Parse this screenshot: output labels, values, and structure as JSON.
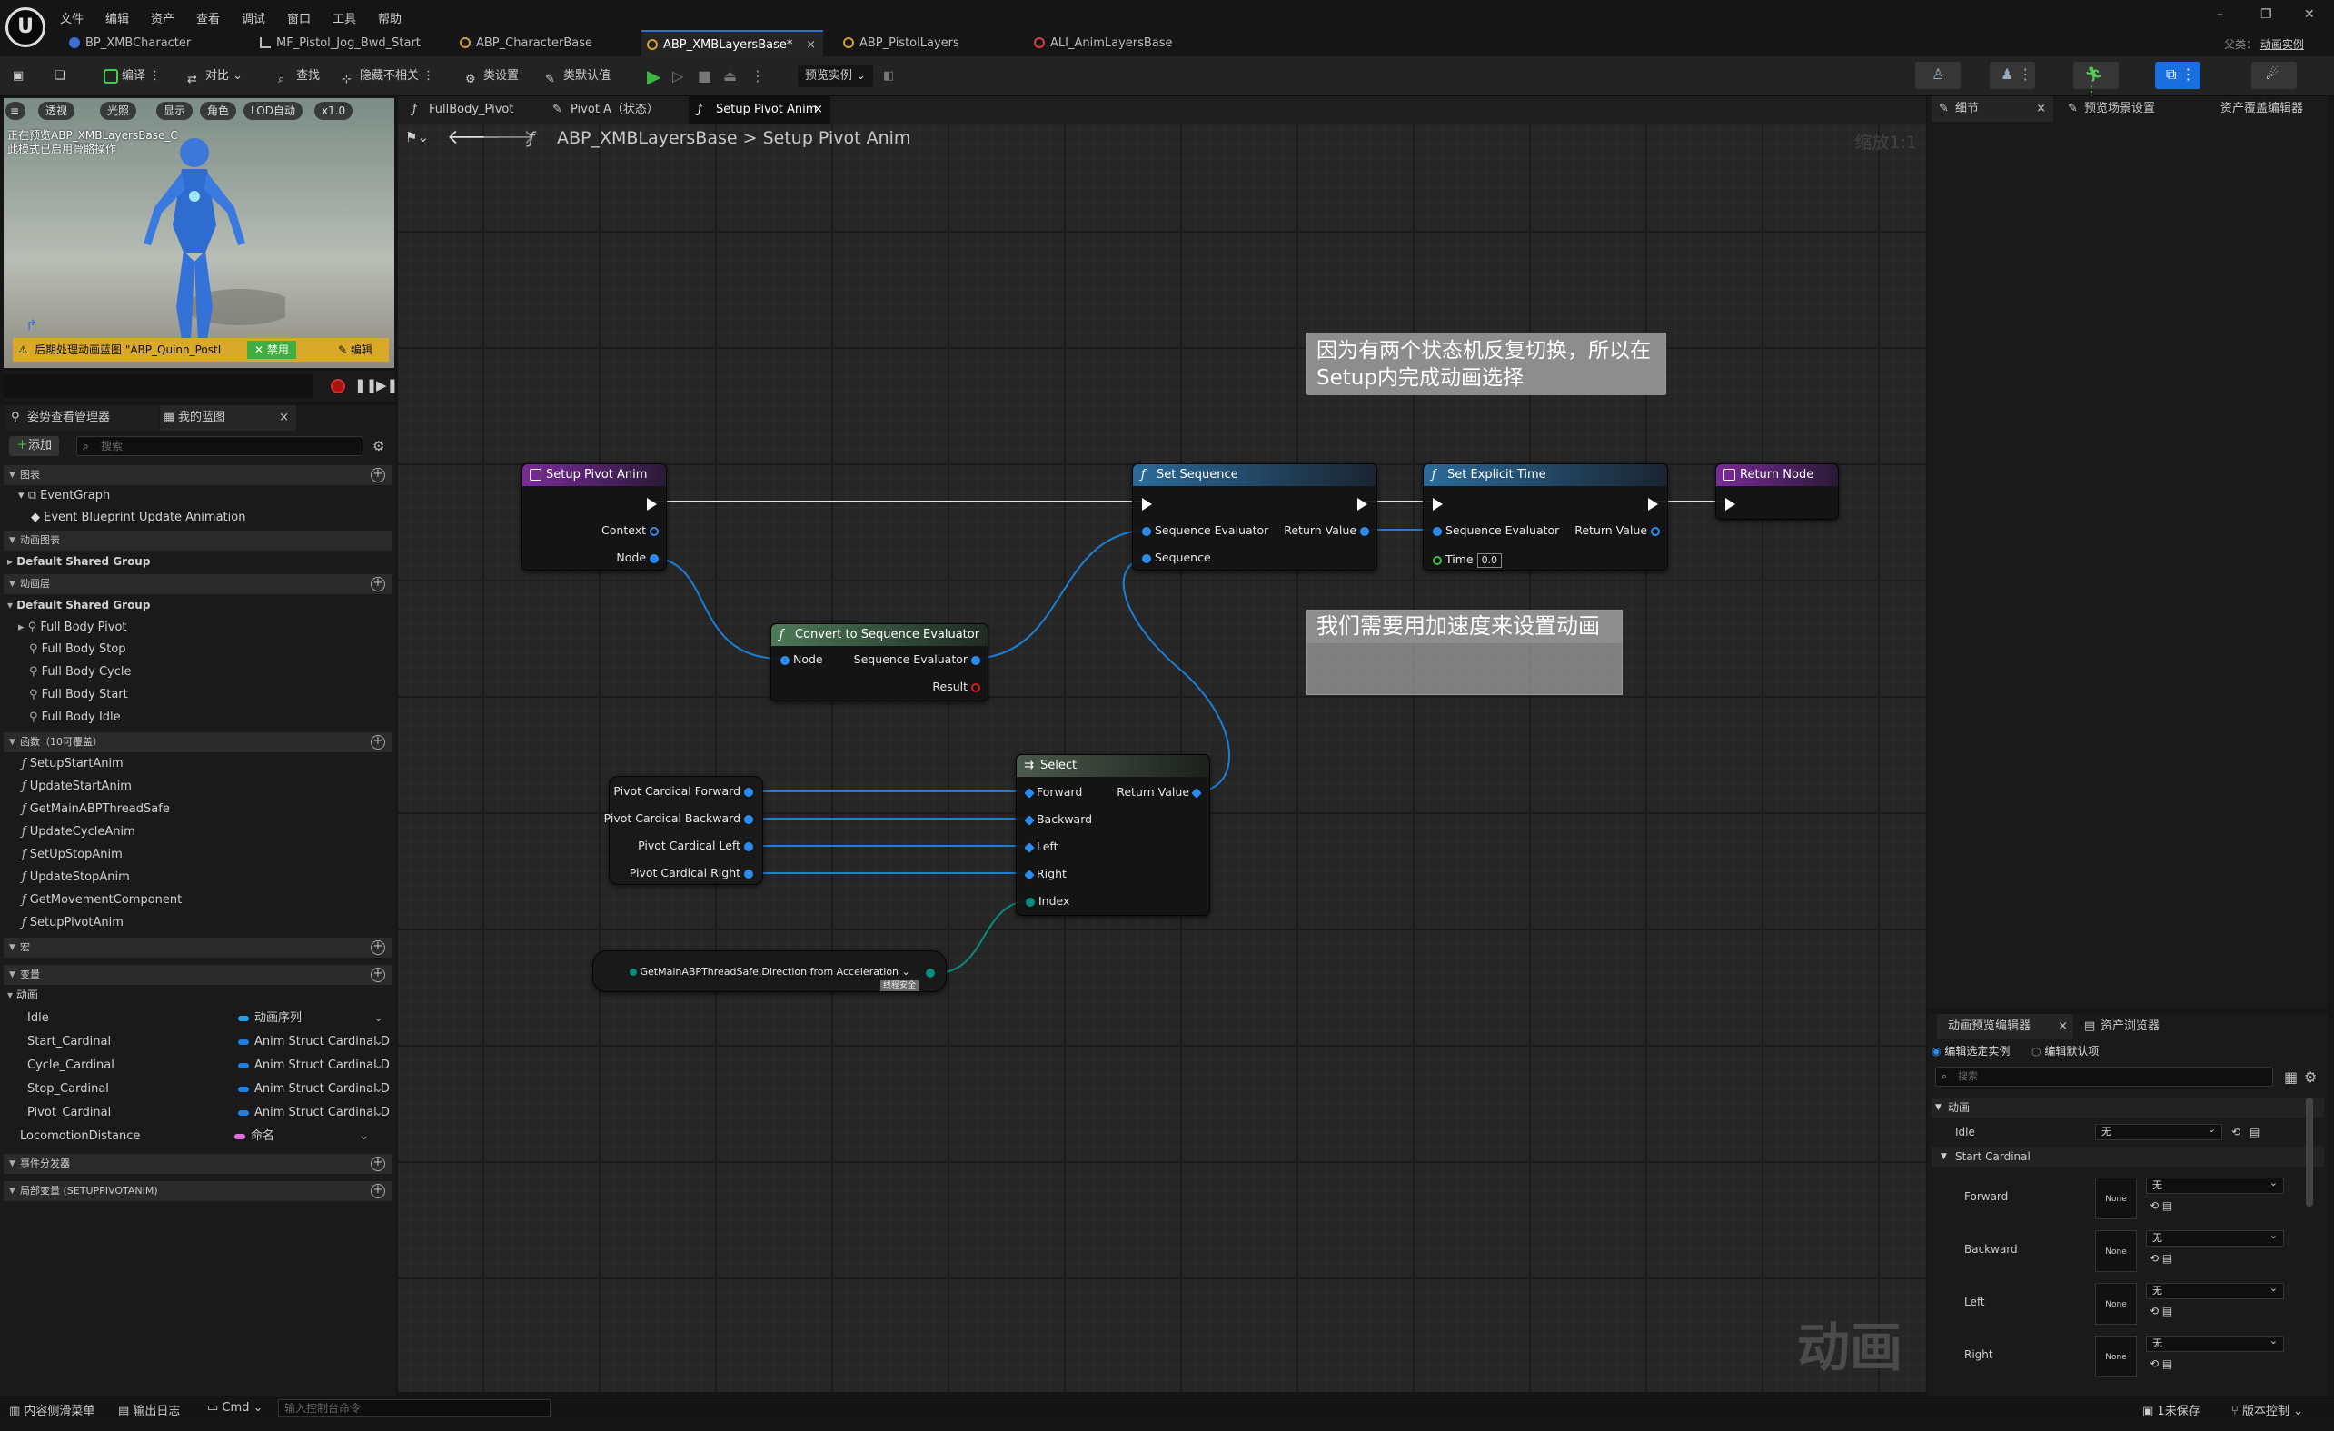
{
  "menu": [
    "文件",
    "编辑",
    "资产",
    "查看",
    "调试",
    "窗口",
    "工具",
    "帮助"
  ],
  "doc_tabs": [
    "BP_XMBCharacter",
    "MF_Pistol_Jog_Bwd_Start",
    "ABP_CharacterBase",
    "ABP_XMBLayersBase*",
    "ABP_PistolLayers",
    "ALI_AnimLayersBase"
  ],
  "title_right": {
    "parent_label": "父类：",
    "parent_value": "动画实例"
  },
  "toolbar": {
    "compile": "编译",
    "diff": "对比",
    "find": "查找",
    "hide": "隐藏不相关",
    "class_settings": "类设置",
    "class_defaults": "类默认值",
    "preview": "预览实例"
  },
  "viewport": {
    "buttons": [
      "透视",
      "光照",
      "显示",
      "角色",
      "LOD自动",
      "x1.0"
    ],
    "message": "正在预览ABP_XMBLayersBase_C\n此模式已启用骨骼操作",
    "warning": "后期处理动画蓝图 \"ABP_Quinn_PostI",
    "disable": "禁用",
    "edit": "编辑"
  },
  "left_tabs": [
    "姿势查看管理器",
    "我的蓝图"
  ],
  "add_label": "添加",
  "search_placeholder": "搜索",
  "sections": {
    "graphs": "图表",
    "anim_graphs": "动画图表",
    "anim_layers": "动画层",
    "functions": "函数（10可覆盖）",
    "macros": "宏",
    "variables": "变量",
    "event_dispatchers": "事件分发器",
    "local_vars": "局部变量 (SETUPPIVOTANIM)"
  },
  "graph_items": [
    "EventGraph",
    "Event Blueprint Update Animation"
  ],
  "default_group": "Default Shared Group",
  "layer_items": [
    "Full Body Pivot",
    "Full Body Stop",
    "Full Body Cycle",
    "Full Body Start",
    "Full Body Idle"
  ],
  "functions": [
    "SetupStartAnim",
    "UpdateStartAnim",
    "GetMainABPThreadSafe",
    "UpdateCycleAnim",
    "SetUpStopAnim",
    "UpdateStopAnim",
    "GetMovementComponent",
    "SetupPivotAnim"
  ],
  "var_group": "动画",
  "variables": [
    {
      "name": "Idle",
      "type": "动画序列",
      "color": "#1fa0f0"
    },
    {
      "name": "Start_Cardinal",
      "type": "Anim Struct Cardinal D",
      "color": "#1f7fe0"
    },
    {
      "name": "Cycle_Cardinal",
      "type": "Anim Struct Cardinal D",
      "color": "#1f7fe0"
    },
    {
      "name": "Stop_Cardinal",
      "type": "Anim Struct Cardinal D",
      "color": "#1f7fe0"
    },
    {
      "name": "Pivot_Cardinal",
      "type": "Anim Struct Cardinal D",
      "color": "#1f7fe0"
    },
    {
      "name": "LocomotionDistance",
      "type": "命名",
      "color": "#e070e0"
    }
  ],
  "graph_tabs": [
    "FullBody_Pivot",
    "Pivot A（状态）",
    "Setup Pivot Anim"
  ],
  "breadcrumb": {
    "root": "ABP_XMBLayersBase",
    "sep": ">",
    "leaf": "Setup Pivot Anim"
  },
  "zoom": "缩放1:1",
  "watermark": "动画",
  "nodes": {
    "entry": {
      "title": "Setup Pivot Anim",
      "pins": [
        "Context",
        "Node"
      ]
    },
    "convert": {
      "title": "Convert to Sequence Evaluator",
      "in": "Node",
      "out1": "Sequence Evaluator",
      "out2": "Result"
    },
    "set_seq": {
      "title": "Set Sequence",
      "in1": "Sequence Evaluator",
      "in2": "Sequence",
      "out": "Return Value"
    },
    "set_time": {
      "title": "Set Explicit Time",
      "in1": "Sequence Evaluator",
      "in2": "Time",
      "time_value": "0.0",
      "out": "Return Value"
    },
    "ret": {
      "title": "Return Node"
    },
    "select": {
      "title": "Select",
      "pins": [
        "Forward",
        "Backward",
        "Left",
        "Right",
        "Index"
      ],
      "out": "Return Value"
    },
    "getters": [
      "Pivot Cardical Forward",
      "Pivot Cardical Backward",
      "Pivot Cardical Left",
      "Pivot Cardical Right"
    ],
    "direction": {
      "title": "GetMainABPThreadSafe.Direction from Acceleration",
      "badge": "线程安全"
    }
  },
  "comments": {
    "c1": "因为有两个状态机反复切换，所以在Setup内完成动画选择",
    "c2": "我们需要用加速度来设置动画"
  },
  "right_tabs": [
    "细节",
    "预览场景设置",
    "资产覆盖编辑器"
  ],
  "rb_tabs": [
    "动画预览编辑器",
    "资产浏览器"
  ],
  "rb_radio": [
    "编辑选定实例",
    "编辑默认项"
  ],
  "rb_section": "动画",
  "rb_idle": {
    "label": "Idle",
    "value": "无"
  },
  "rb_start": "Start Cardinal",
  "rb_rows": [
    {
      "label": "Forward",
      "thumb": "None",
      "value": "无"
    },
    {
      "label": "Backward",
      "thumb": "None",
      "value": "无"
    },
    {
      "label": "Left",
      "thumb": "None",
      "value": "无"
    },
    {
      "label": "Right",
      "thumb": "None",
      "value": "无"
    }
  ],
  "status": {
    "drawer": "内容侧滑菜单",
    "log": "输出日志",
    "cmd": "Cmd",
    "cmd_placeholder": "输入控制台命令",
    "unsaved": "1未保存",
    "vcs": "版本控制"
  }
}
